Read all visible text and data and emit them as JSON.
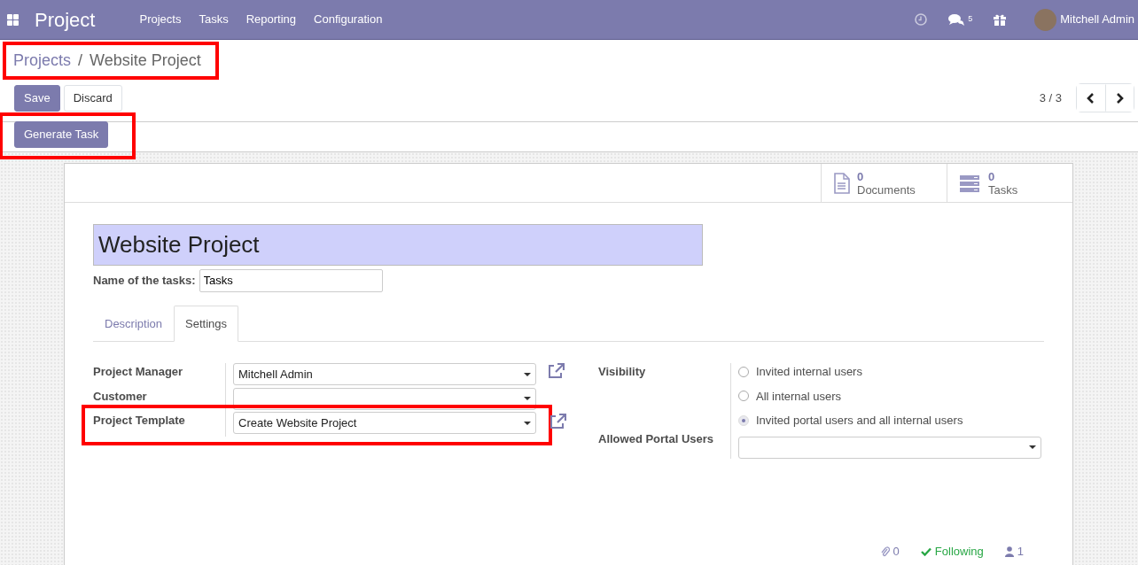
{
  "navbar": {
    "app_title": "Project",
    "menu": [
      {
        "label": "Projects"
      },
      {
        "label": "Tasks"
      },
      {
        "label": "Reporting"
      },
      {
        "label": "Configuration"
      }
    ],
    "messages_count": "5",
    "user": "Mitchell Admin"
  },
  "breadcrumb": {
    "highlighted": true,
    "items": [
      {
        "label": "Projects",
        "kind": "link"
      },
      {
        "label": "/",
        "kind": "separator"
      },
      {
        "label": "Website Project",
        "kind": "current"
      }
    ]
  },
  "actions": [
    {
      "label": "Save",
      "kind": "primary"
    },
    {
      "label": "Discard",
      "kind": "secondary"
    }
  ],
  "pager": {
    "text": "3 / 3"
  },
  "header_buttons": [
    {
      "label": "Generate Task",
      "highlighted": true
    }
  ],
  "stat_buttons": [
    {
      "count": "0",
      "label": "Documents",
      "kind": "document"
    },
    {
      "count": "0",
      "label": "Tasks",
      "kind": "tasks"
    }
  ],
  "record": {
    "name": "Website Project",
    "tasks_label": "Name of the tasks:",
    "tasks_value": "Tasks"
  },
  "tabs": [
    {
      "label": "Description",
      "selected": false
    },
    {
      "label": "Settings",
      "selected": true
    }
  ],
  "left_fields": [
    {
      "label": "Project Manager",
      "value": "Mitchell Admin",
      "external_link": true,
      "highlighted": false
    },
    {
      "label": "Customer",
      "external_link": false,
      "highlighted": false
    },
    {
      "label": "Project Template",
      "value": "Create Website Project",
      "external_link": true,
      "highlighted": true
    }
  ],
  "visibility": {
    "label": "Visibility",
    "options": [
      {
        "label": "Invited internal users",
        "selected": false
      },
      {
        "label": "All internal users",
        "selected": false
      },
      {
        "label": "Invited portal users and all internal users",
        "selected": true
      }
    ]
  },
  "portal_users": {
    "label": "Allowed Portal Users"
  },
  "chatter": {
    "attachments": "0",
    "following": "Following",
    "followers": "1"
  }
}
